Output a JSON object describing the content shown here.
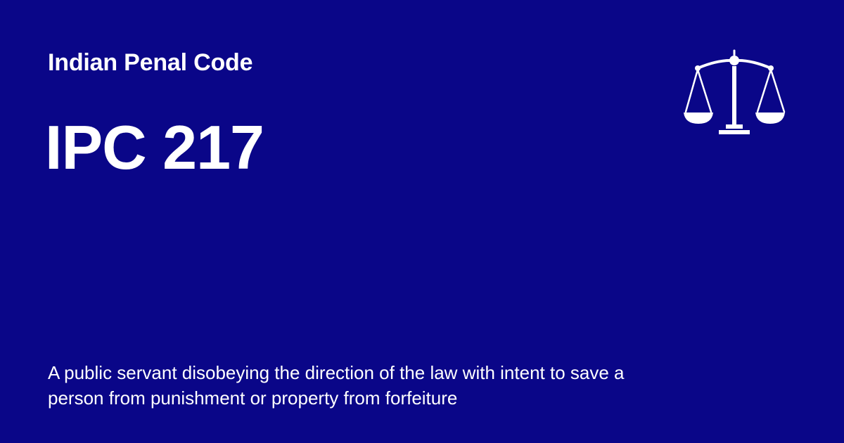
{
  "header": {
    "eyebrow": "Indian Penal Code",
    "title": "IPC 217"
  },
  "description": "A public servant disobeying the direction of the law with intent to save a person from punishment or property from forfeiture",
  "icon": {
    "name": "scales-of-justice-icon"
  },
  "colors": {
    "background": "#0a0688",
    "text": "#ffffff"
  }
}
